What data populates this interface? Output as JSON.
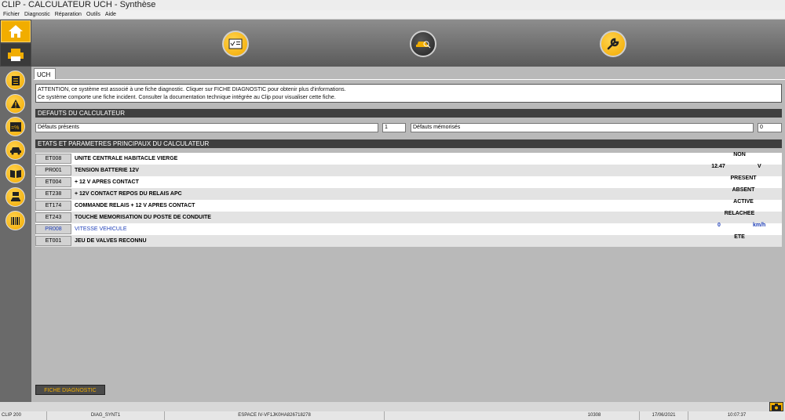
{
  "window": {
    "title": "CLIP - CALCULATEUR UCH - Synthèse"
  },
  "menu": [
    "Fichier",
    "Diagnostic",
    "Réparation",
    "Outils",
    "Aide"
  ],
  "tab": {
    "label": "UCH"
  },
  "notice": {
    "line1": "ATTENTION, ce système est associé à une fiche diagnostic. Cliquer sur FICHE DIAGNOSTIC pour obtenir plus d'informations.",
    "line2": "Ce système comporte une fiche incident. Consulter la documentation technique intégrée au Clip pour visualiser cette fiche."
  },
  "defauts": {
    "header": "DEFAUTS DU CALCULATEUR",
    "present_label": "Défauts présents",
    "present_count": "1",
    "memo_label": "Défauts mémorisés",
    "memo_count": "0"
  },
  "params": {
    "header": "ETATS ET PARAMETRES PRINCIPAUX DU CALCULATEUR",
    "rows": [
      {
        "code": "ET008",
        "label": "UNITE CENTRALE HABITACLE VIERGE",
        "value": "NON",
        "unit": ""
      },
      {
        "code": "PR001",
        "label": "TENSION BATTERIE 12V",
        "value": "12.47",
        "unit": "V"
      },
      {
        "code": "ET004",
        "label": "+ 12 V APRES CONTACT",
        "value": "PRESENT",
        "unit": ""
      },
      {
        "code": "ET238",
        "label": "+ 12V CONTACT REPOS DU RELAIS APC",
        "value": "ABSENT",
        "unit": ""
      },
      {
        "code": "ET174",
        "label": "COMMANDE RELAIS + 12 V APRES CONTACT",
        "value": "ACTIVE",
        "unit": ""
      },
      {
        "code": "ET243",
        "label": "TOUCHE MEMORISATION DU POSTE DE CONDUITE",
        "value": "RELACHEE",
        "unit": ""
      },
      {
        "code": "PR008",
        "label": "VITESSE VEHICULE",
        "value": "0",
        "unit": "km/h"
      },
      {
        "code": "ET001",
        "label": "JEU DE VALVES RECONNU",
        "value": "ETE",
        "unit": ""
      }
    ]
  },
  "fiche_button": "FICHE DIAGNOSTIC",
  "status": {
    "product": "CLIP 200",
    "screen": "DIAG_SYNT1",
    "vehicle": "ESPACE IV-VF1JK0HA826718278",
    "code": "10308",
    "date": "17/06/2021",
    "time": "10:07:37"
  },
  "colors": {
    "accent": "#f1ad00",
    "header": "#3f3f3f",
    "link": "#1f3fb8"
  }
}
